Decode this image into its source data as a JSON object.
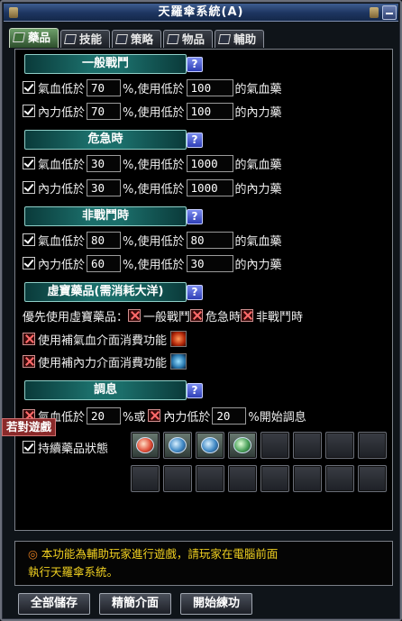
{
  "window": {
    "title": "天羅傘系統(A)"
  },
  "tabs": [
    {
      "label": "藥品",
      "active": true
    },
    {
      "label": "技能",
      "active": false
    },
    {
      "label": "策略",
      "active": false
    },
    {
      "label": "物品",
      "active": false
    },
    {
      "label": "輔助",
      "active": false
    }
  ],
  "help_label": "?",
  "sections": {
    "combat": {
      "title": "一般戰鬥",
      "hp": {
        "prefix": "氣血低於",
        "percent": "70",
        "mid": "%,使用低於",
        "amount": "100",
        "suffix": "的氣血藥"
      },
      "mp": {
        "prefix": "內力低於",
        "percent": "70",
        "mid": "%,使用低於",
        "amount": "100",
        "suffix": "的內力藥"
      }
    },
    "danger": {
      "title": "危急時",
      "hp": {
        "prefix": "氣血低於",
        "percent": "30",
        "mid": "%,使用低於",
        "amount": "1000",
        "suffix": "的氣血藥"
      },
      "mp": {
        "prefix": "內力低於",
        "percent": "30",
        "mid": "%,使用低於",
        "amount": "1000",
        "suffix": "的內力藥"
      }
    },
    "noncombat": {
      "title": "非戰鬥時",
      "hp": {
        "prefix": "氣血低於",
        "percent": "80",
        "mid": "%,使用低於",
        "amount": "80",
        "suffix": "的氣血藥"
      },
      "mp": {
        "prefix": "內力低於",
        "percent": "60",
        "mid": "%,使用低於",
        "amount": "30",
        "suffix": "的內力藥"
      }
    },
    "treasure": {
      "title": "虛寶藥品(需消耗大洋)",
      "priority_label": "優先使用虛寶藥品：",
      "opt_combat": "一般戰鬥",
      "opt_danger": "危急時",
      "opt_noncombat": "非戰鬥時",
      "use_hp_ui": "使用補氣血介面消費功能",
      "use_mp_ui": "使用補內力介面消費功能"
    },
    "adjust": {
      "title": "調息",
      "hp_prefix": "氣血低於",
      "hp_percent": "20",
      "or_text": "%或",
      "mp_prefix": "內力低於",
      "mp_percent": "20",
      "end_text": "%開始調息",
      "sustain_label": "持續藥品狀態",
      "tooltip": "若對遊戲"
    }
  },
  "notice": {
    "star": "◎",
    "line1": "本功能為輔助玩家進行遊戲，請玩家在電腦前面",
    "line2": "執行天羅傘系統。"
  },
  "buttons": {
    "save_all": "全部儲存",
    "simple_ui": "精簡介面",
    "start": "開始練功"
  }
}
